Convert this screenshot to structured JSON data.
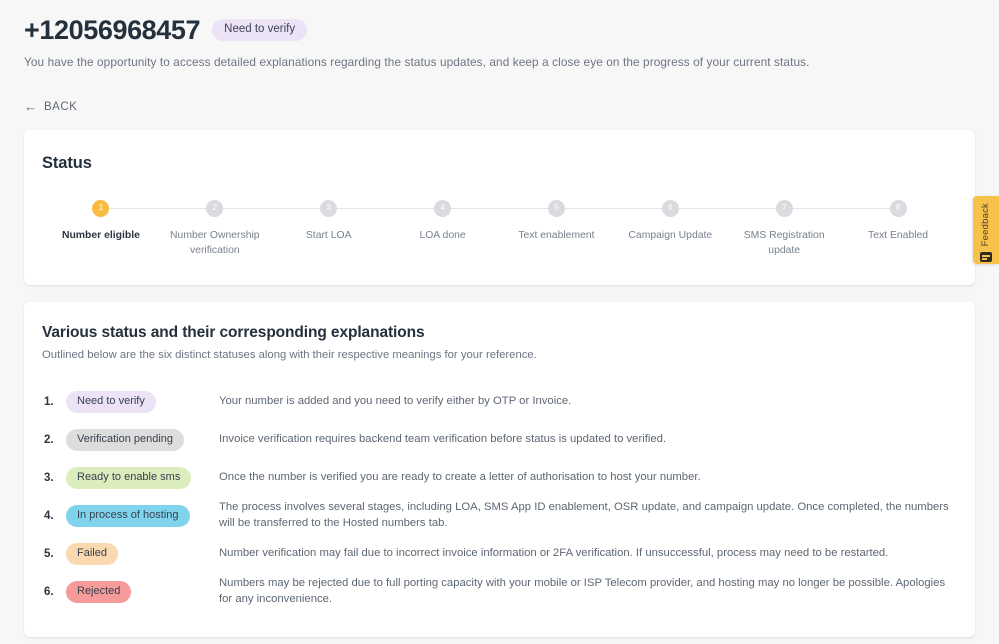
{
  "header": {
    "phone_number": "+12056968457",
    "status_pill": "Need to verify",
    "status_pill_color": "#ece4f6",
    "subtitle": "You have the opportunity to access detailed explanations regarding the status updates, and keep a close eye on the progress of your current status."
  },
  "back": {
    "arrow": "back-arrow-icon",
    "label": "BACK"
  },
  "status_card": {
    "title": "Status",
    "active_color": "#f9bc42",
    "inactive_color": "#d9dbdf",
    "steps": [
      {
        "number": "1",
        "label": "Number eligible",
        "active": true
      },
      {
        "number": "2",
        "label": "Number Ownership verification",
        "active": false
      },
      {
        "number": "3",
        "label": "Start LOA",
        "active": false
      },
      {
        "number": "4",
        "label": "LOA done",
        "active": false
      },
      {
        "number": "5",
        "label": "Text enablement",
        "active": false
      },
      {
        "number": "6",
        "label": "Campaign Update",
        "active": false
      },
      {
        "number": "7",
        "label": "SMS Registration update",
        "active": false
      },
      {
        "number": "8",
        "label": "Text Enabled",
        "active": false
      }
    ]
  },
  "explanations_card": {
    "title": "Various status and their corresponding explanations",
    "subtitle": "Outlined below are the six distinct statuses along with their respective meanings for your reference.",
    "rows": [
      {
        "index": "1.",
        "badge": "Need to verify",
        "badge_color": "#ece4f6",
        "description": "Your number is added and you need to verify either by OTP or Invoice."
      },
      {
        "index": "2.",
        "badge": "Verification pending",
        "badge_color": "#dddddd",
        "description": "Invoice verification requires backend team verification before status is updated to verified."
      },
      {
        "index": "3.",
        "badge": "Ready to enable sms",
        "badge_color": "#dcedbd",
        "description": "Once the number is verified you are ready to create a letter of authorisation to host your number."
      },
      {
        "index": "4.",
        "badge": "In process of hosting",
        "badge_color": "#7fd4ec",
        "description": "The process involves several stages, including LOA, SMS App ID enablement, OSR update, and campaign update. Once completed, the numbers will be transferred to the Hosted numbers tab."
      },
      {
        "index": "5.",
        "badge": "Failed",
        "badge_color": "#fbd9b0",
        "description": "Number verification may fail due to incorrect invoice information or 2FA verification. If unsuccessful, process may need to be restarted."
      },
      {
        "index": "6.",
        "badge": "Rejected",
        "badge_color": "#f79a9a",
        "description": "Numbers may be rejected due to full porting capacity with your mobile or ISP Telecom provider, and hosting may no longer be possible. Apologies for any inconvenience."
      }
    ]
  },
  "feedback": {
    "label": "Feedback",
    "icon": "feedback-message-icon",
    "color": "#f7c24b"
  }
}
